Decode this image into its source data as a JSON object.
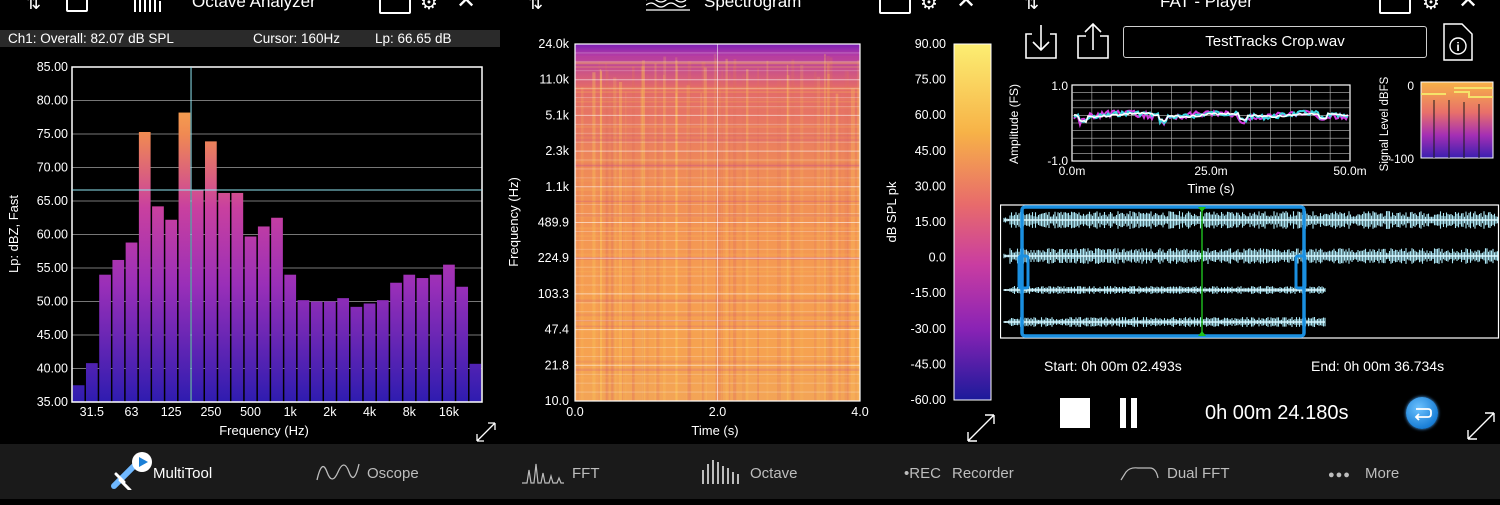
{
  "panels": {
    "octave": {
      "title": "Octave Analyzer",
      "status": {
        "overall": "Ch1: Overall: 82.07 dB SPL",
        "cursor": "Cursor: 160Hz",
        "lp": "Lp: 66.65 dB"
      },
      "icons": [
        "channel-swap-icon",
        "waveform-icon",
        "octave-bars-icon",
        "trace-icon",
        "gear-icon",
        "close-icon",
        "expand-icon"
      ]
    },
    "spectrogram": {
      "title": "Spectrogram",
      "icons": [
        "channel-swap-icon",
        "spectrogram-icon",
        "trace-icon",
        "gear-icon",
        "close-icon",
        "expand-icon"
      ]
    },
    "player": {
      "title": "FAT - Player",
      "file_name": "TestTracks Crop.wav",
      "start_label": "Start: 0h 00m 02.493s",
      "end_label": "End: 0h 00m 36.734s",
      "time_display": "0h 00m 24.180s",
      "icons": [
        "channel-swap-icon",
        "download-icon",
        "share-icon",
        "file-info-icon",
        "stop-icon",
        "pause-icon",
        "loop-icon",
        "trace-icon",
        "gear-icon",
        "expand-icon"
      ]
    }
  },
  "tabs": [
    {
      "label": "MultiTool",
      "icon": "multitool-icon",
      "active": true
    },
    {
      "label": "Oscope",
      "icon": "oscope-wave-icon",
      "active": false
    },
    {
      "label": "FFT",
      "icon": "fft-peaks-icon",
      "active": false
    },
    {
      "label": "Octave",
      "icon": "octave-bars-icon",
      "active": false
    },
    {
      "label": "Recorder",
      "icon": "record-icon",
      "prefix": "•REC",
      "active": false
    },
    {
      "label": "Dual FFT",
      "icon": "dual-fft-icon",
      "active": false
    },
    {
      "label": "More",
      "icon": "more-dots-icon",
      "prefix": "●●●",
      "active": false
    }
  ],
  "chart_data": [
    {
      "type": "bar",
      "xlabel": "Frequency (Hz)",
      "ylabel": "Lp: dBZ, Fast",
      "ylim": [
        35,
        85
      ],
      "y_ticks": [
        "85.00",
        "80.00",
        "75.00",
        "70.00",
        "65.00",
        "60.00",
        "55.00",
        "50.00",
        "45.00",
        "40.00",
        "35.00"
      ],
      "x_tick_labels": [
        "31.5",
        "63",
        "125",
        "250",
        "500",
        "1k",
        "2k",
        "4k",
        "8k",
        "16k"
      ],
      "cursor_frequency": "160Hz",
      "cursor_level": 66.65,
      "values": [
        37.5,
        40.8,
        54.0,
        56.2,
        58.8,
        75.3,
        64.2,
        62.2,
        78.2,
        66.7,
        73.9,
        66.2,
        66.2,
        59.7,
        61.2,
        62.5,
        54.0,
        50.2,
        50.0,
        50.0,
        50.5,
        49.2,
        49.7,
        50.2,
        52.8,
        54.0,
        53.5,
        54.0,
        55.5,
        52.2,
        40.7
      ],
      "colors": {
        "bar_high": "#f7a83c",
        "bar_mid": "#c23ea4",
        "bar_low": "#3a1fb0",
        "cursor": "#8fe6f2"
      }
    },
    {
      "type": "heatmap",
      "xlabel": "Time (s)",
      "ylabel": "Frequency (Hz)",
      "x_ticks": [
        "0.0",
        "2.0",
        "4.0"
      ],
      "xlim": [
        0,
        4
      ],
      "y_ticks": [
        "24.0k",
        "11.0k",
        "5.1k",
        "2.3k",
        "1.1k",
        "489.9",
        "224.9",
        "103.3",
        "47.4",
        "21.8",
        "10.0"
      ],
      "colorbar": {
        "label": "dB SPL pk",
        "ticks": [
          "90.00",
          "75.00",
          "60.00",
          "45.00",
          "30.00",
          "15.00",
          "0.0",
          "-15.00",
          "-30.00",
          "-45.00",
          "-60.00"
        ],
        "range": [
          -60,
          90
        ]
      }
    },
    {
      "type": "line",
      "xlabel": "Time (s)",
      "ylabel": "Amplitude (FS)",
      "ylim": [
        -1.0,
        1.0
      ],
      "y_ticks": [
        "1.0",
        "-1.0"
      ],
      "x_ticks": [
        "0.0m",
        "25.0m",
        "50.0m"
      ]
    },
    {
      "type": "bar",
      "ylabel": "Signal Level dBFS",
      "y_ticks": [
        "0",
        "-100"
      ],
      "ylim": [
        -100,
        0
      ]
    }
  ],
  "colors": {
    "accent_blue": "#1a8fe0",
    "wave": "#aee9f7",
    "playhead": "#1fc21f",
    "tabbar_bg": "#1a1a1a"
  }
}
